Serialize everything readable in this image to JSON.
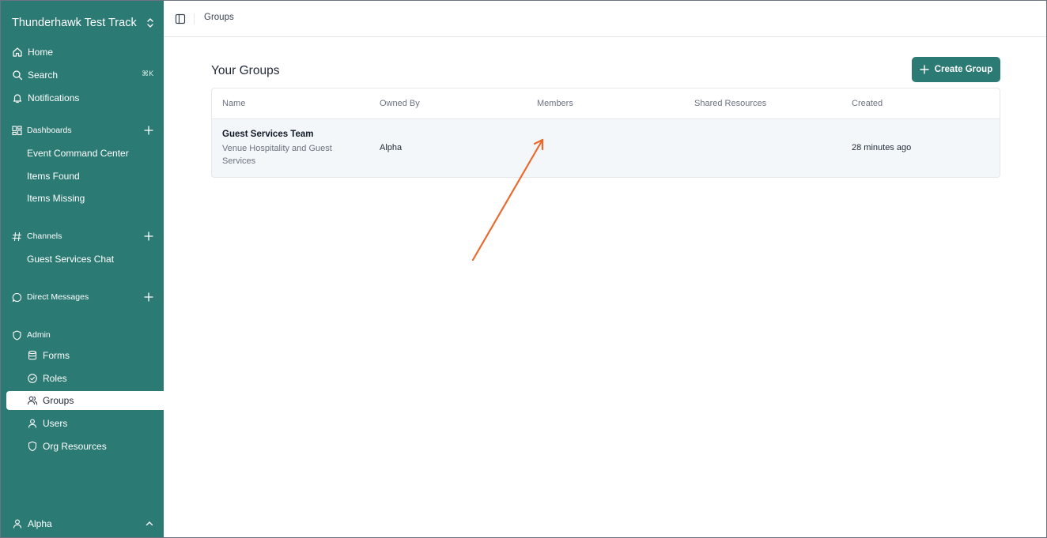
{
  "sidebar": {
    "workspace_title": "Thunderhawk Test Track",
    "nav": [
      {
        "label": "Home",
        "icon": "home-icon"
      },
      {
        "label": "Search",
        "icon": "search-icon",
        "shortcut": "⌘K"
      },
      {
        "label": "Notifications",
        "icon": "bell-icon"
      }
    ],
    "dashboards": {
      "label": "Dashboards",
      "items": [
        "Event Command Center",
        "Items Found",
        "Items Missing"
      ]
    },
    "channels": {
      "label": "Channels",
      "items": [
        "Guest Services Chat"
      ]
    },
    "direct_messages": {
      "label": "Direct Messages"
    },
    "admin": {
      "label": "Admin",
      "items": [
        {
          "label": "Forms",
          "icon": "database-icon"
        },
        {
          "label": "Roles",
          "icon": "check-circle-icon"
        },
        {
          "label": "Groups",
          "icon": "users-icon",
          "active": true
        },
        {
          "label": "Users",
          "icon": "user-icon"
        },
        {
          "label": "Org Resources",
          "icon": "shield-icon"
        }
      ]
    },
    "user": {
      "label": "Alpha"
    }
  },
  "topbar": {
    "breadcrumb": "Groups"
  },
  "main": {
    "title": "Your Groups",
    "create_button": "Create Group",
    "table": {
      "columns": [
        "Name",
        "Owned By",
        "Members",
        "Shared Resources",
        "Created"
      ],
      "rows": [
        {
          "name": "Guest Services Team",
          "description": "Venue Hospitality and Guest Services",
          "owned_by": "Alpha",
          "members": "",
          "shared_resources": "",
          "created": "28 minutes ago"
        }
      ]
    }
  },
  "colors": {
    "sidebar_bg": "#2b7a73",
    "accent": "#2b7a73",
    "annotation_arrow": "#ea6a2e"
  }
}
